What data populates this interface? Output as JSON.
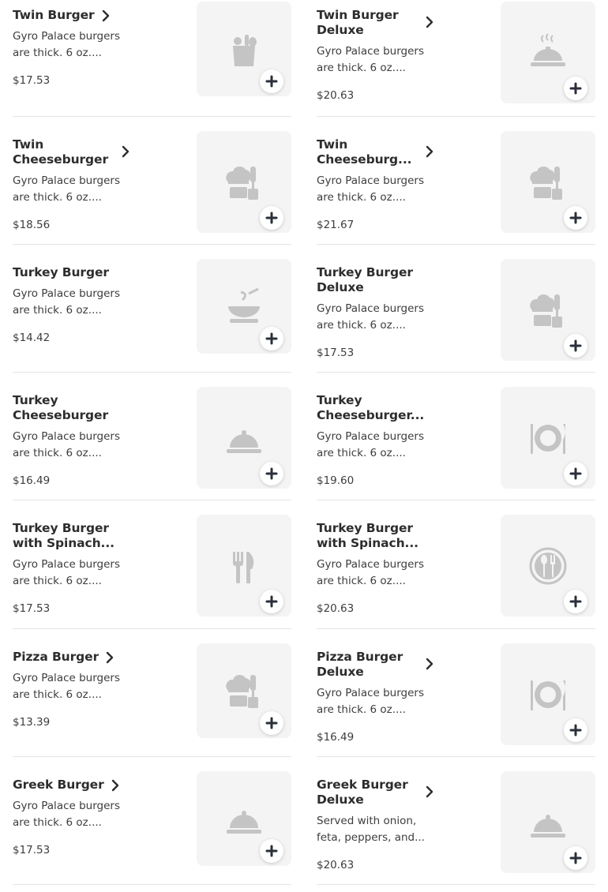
{
  "menu_items": [
    {
      "name": "Twin Burger",
      "description": "Gyro Palace burgers are thick. 6 oz....",
      "price": "$17.53",
      "icon": "grocery-bag-icon"
    },
    {
      "name": "Twin Burger Deluxe",
      "description": "Gyro Palace burgers are thick. 6 oz....",
      "price": "$20.63",
      "icon": "hot-dish-icon"
    },
    {
      "name": "Twin Cheeseburger",
      "description": "Gyro Palace burgers are thick. 6 oz....",
      "price": "$18.56",
      "icon": "chef-hat-spatula-icon"
    },
    {
      "name": "Twin Cheeseburg...",
      "description": "Gyro Palace burgers are thick. 6 oz....",
      "price": "$21.67",
      "icon": "chef-hat-spatula-icon"
    },
    {
      "name": "Turkey Burger",
      "description": "Gyro Palace burgers are thick. 6 oz....",
      "price": "$14.42",
      "icon": "soup-bowl-icon"
    },
    {
      "name": "Turkey Burger Deluxe",
      "description": "Gyro Palace burgers are thick. 6 oz....",
      "price": "$17.53",
      "icon": "chef-hat-spatula-icon"
    },
    {
      "name": "Turkey Cheeseburger",
      "description": "Gyro Palace burgers are thick. 6 oz....",
      "price": "$16.49",
      "icon": "cloche-icon"
    },
    {
      "name": "Turkey Cheeseburger...",
      "description": "Gyro Palace burgers are thick. 6 oz....",
      "price": "$19.60",
      "icon": "plate-cutlery-icon"
    },
    {
      "name": "Turkey Burger with Spinach...",
      "description": "Gyro Palace burgers are thick. 6 oz....",
      "price": "$17.53",
      "icon": "fork-knife-icon"
    },
    {
      "name": "Turkey Burger with Spinach...",
      "description": "Gyro Palace burgers are thick. 6 oz....",
      "price": "$20.63",
      "icon": "circle-spoon-fork-icon"
    },
    {
      "name": "Pizza Burger",
      "description": "Gyro Palace burgers are thick. 6 oz....",
      "price": "$13.39",
      "icon": "chef-hat-spatula-icon"
    },
    {
      "name": "Pizza Burger Deluxe",
      "description": "Gyro Palace burgers are thick. 6 oz....",
      "price": "$16.49",
      "icon": "plate-cutlery-icon"
    },
    {
      "name": "Greek Burger",
      "description": "Gyro Palace burgers are thick. 6 oz....",
      "price": "$17.53",
      "icon": "cloche-icon"
    },
    {
      "name": "Greek Burger Deluxe",
      "description": "Served with onion, feta, peppers, and...",
      "price": "$20.63",
      "icon": "cloche-icon"
    }
  ],
  "colors": {
    "icon_gray": "#c4c4c4",
    "add_icon": "#2a2f3a",
    "thumb_bg": "#f4f4f4"
  }
}
